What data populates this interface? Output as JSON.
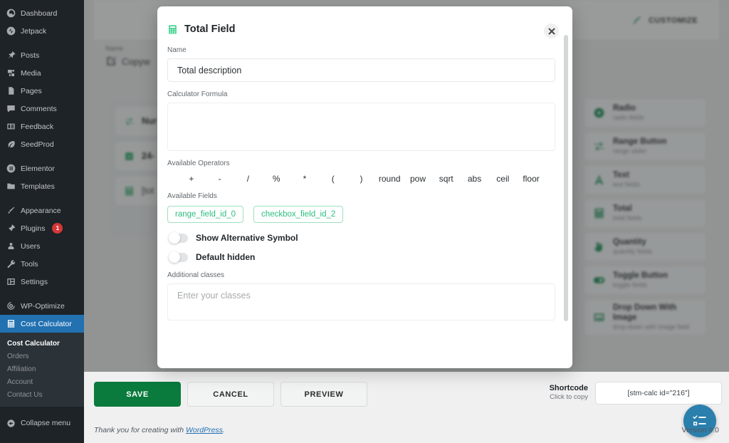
{
  "wp_sidebar": {
    "items": [
      {
        "label": "Dashboard",
        "icon": "dashboard-icon"
      },
      {
        "label": "Jetpack",
        "icon": "jetpack-icon"
      },
      {
        "label": "Posts",
        "icon": "pin-icon"
      },
      {
        "label": "Media",
        "icon": "media-icon"
      },
      {
        "label": "Pages",
        "icon": "pages-icon"
      },
      {
        "label": "Comments",
        "icon": "comments-icon"
      },
      {
        "label": "Feedback",
        "icon": "feedback-icon"
      },
      {
        "label": "SeedProd",
        "icon": "seedprod-icon"
      },
      {
        "label": "Elementor",
        "icon": "elementor-icon"
      },
      {
        "label": "Templates",
        "icon": "templates-icon"
      },
      {
        "label": "Appearance",
        "icon": "brush-icon"
      },
      {
        "label": "Plugins",
        "icon": "plugins-icon",
        "badge": "1"
      },
      {
        "label": "Users",
        "icon": "users-icon"
      },
      {
        "label": "Tools",
        "icon": "wrench-icon"
      },
      {
        "label": "Settings",
        "icon": "settings-icon"
      },
      {
        "label": "WP-Optimize",
        "icon": "optimize-icon"
      },
      {
        "label": "Cost Calculator",
        "icon": "calculator-icon",
        "active": true
      }
    ],
    "submenu": [
      {
        "label": "Cost Calculator",
        "current": true
      },
      {
        "label": "Orders"
      },
      {
        "label": "Affiliation"
      },
      {
        "label": "Account"
      },
      {
        "label": "Contact Us"
      }
    ],
    "collapse_label": "Collapse menu"
  },
  "builder": {
    "customize_label": "CUSTOMIZE",
    "name_label": "Name",
    "name_value": "Copyw",
    "field_rows": [
      {
        "label": "Nur",
        "icon": "range-icon"
      },
      {
        "label": "24-",
        "icon": "checkbox-icon"
      },
      {
        "label": "[tot",
        "icon": "calculator-icon"
      }
    ],
    "palette": [
      {
        "title": "Radio",
        "subtitle": "radio fields",
        "icon": "radio-icon"
      },
      {
        "title": "Range Button",
        "subtitle": "range slider",
        "icon": "range-icon"
      },
      {
        "title": "Text",
        "subtitle": "text fields",
        "icon": "text-a-icon"
      },
      {
        "title": "Total",
        "subtitle": "total fields",
        "icon": "calculator-icon"
      },
      {
        "title": "Quantity",
        "subtitle": "quantity fields",
        "icon": "hand-icon"
      },
      {
        "title": "Toggle Button",
        "subtitle": "toggle fields",
        "icon": "toggle-icon"
      },
      {
        "title": "Drop Down With Image",
        "subtitle": "drop-down with image field",
        "icon": "image-icon"
      }
    ]
  },
  "modal": {
    "title": "Total Field",
    "title_icon": "calculator-icon",
    "close_icon": "close-icon",
    "name_label": "Name",
    "name_value": "Total description",
    "formula_label": "Calculator Formula",
    "formula_value": "",
    "operators_label": "Available Operators",
    "operators": [
      "+",
      "-",
      "/",
      "%",
      "*",
      "(",
      ")",
      "round",
      "pow",
      "sqrt",
      "abs",
      "ceil",
      "floor"
    ],
    "fields_label": "Available Fields",
    "fields": [
      "range_field_id_0",
      "checkbox_field_id_2"
    ],
    "toggles": [
      {
        "label": "Show Alternative Symbol",
        "on": false
      },
      {
        "label": "Default hidden",
        "on": false
      }
    ],
    "classes_label": "Additional classes",
    "classes_placeholder": "Enter your classes",
    "classes_value": ""
  },
  "bottom_bar": {
    "save_label": "SAVE",
    "cancel_label": "CANCEL",
    "preview_label": "PREVIEW",
    "shortcode_title": "Shortcode",
    "shortcode_sub": "Click to copy",
    "shortcode_value": "[stm-calc id=\"216\"]",
    "fab_icon": "form-checklist-icon",
    "credit_prefix": "Thank you for creating with ",
    "credit_link": "WordPress",
    "credit_suffix": ".",
    "version": "Version 6.0"
  },
  "colors": {
    "wp_sidebar_bg": "#1d2327",
    "wp_active_blue": "#2271b1",
    "brand_green": "#0a7a3d",
    "accent_green": "#2ecc82",
    "badge_red": "#d63638",
    "fab_blue": "#2b7fad"
  }
}
